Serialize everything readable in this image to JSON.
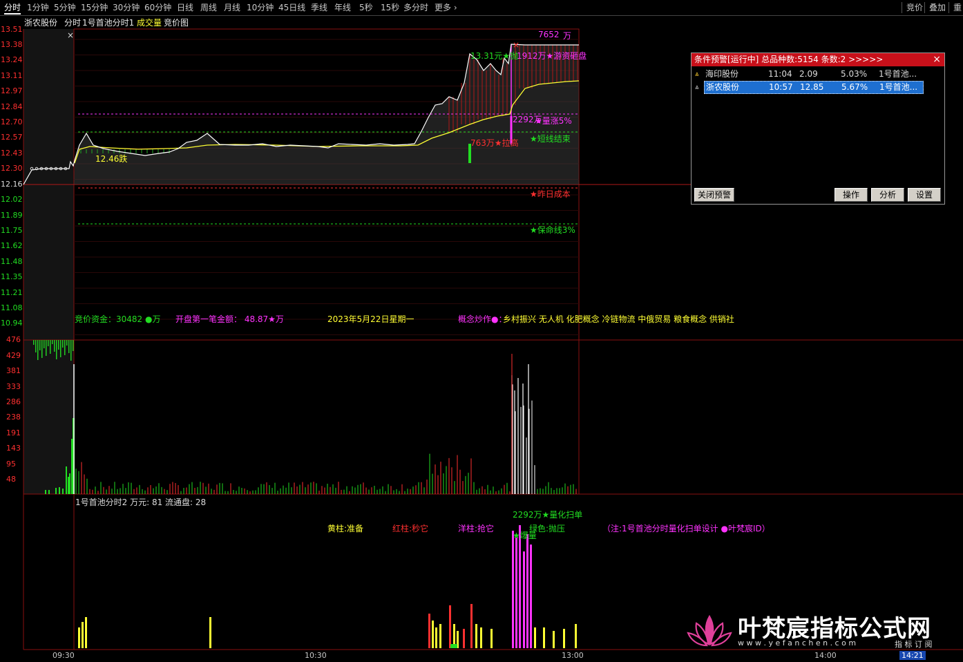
{
  "toolbar": {
    "tabs": [
      "分时",
      "1分钟",
      "5分钟",
      "15分钟",
      "30分钟",
      "60分钟",
      "日线",
      "周线",
      "月线",
      "10分钟",
      "45日线",
      "季线",
      "年线",
      "5秒",
      "15秒",
      "多分时",
      "更多"
    ],
    "right": [
      "竞价",
      "叠加",
      "重"
    ]
  },
  "title": {
    "stock": "浙农股份",
    "sections": [
      "分时",
      "1号首池分时1",
      "成交量",
      "竞价图"
    ]
  },
  "price_axis": [
    "13.51",
    "13.38",
    "13.24",
    "13.11",
    "12.97",
    "12.84",
    "12.70",
    "12.57",
    "12.43",
    "12.30",
    "12.16",
    "12.02",
    "11.89",
    "11.75",
    "11.62",
    "11.48",
    "11.35",
    "11.21",
    "11.08",
    "10.94"
  ],
  "volume_axis": [
    "476",
    "429",
    "381",
    "333",
    "286",
    "238",
    "191",
    "143",
    "95",
    "48"
  ],
  "time_axis": [
    "09:30",
    "10:30",
    "13:00",
    "14:00",
    "14:21"
  ],
  "annotations": {
    "top_value": "7652",
    "top_unit": "万",
    "price_low_label": "12.46跌",
    "high_label": "13.31元★抛",
    "high_amount": "1912万★游资砸盘",
    "mid_amount": "2292万",
    "mid_label": "★量涨5%",
    "low_amount": "763万★拉高",
    "short_end": "★短线结束",
    "yesterday_cost": "★昨日成本",
    "lifeline": "★保命线3%"
  },
  "info_row": {
    "auction_fund": "竞价资金：30482 ●万",
    "first_trade": "开盘第一笔金额：  48.87★万",
    "date": "2023年5月22日星期一",
    "concept_label": "概念炒作●：",
    "concepts": "乡村振兴 无人机 化肥概念 冷链物流 中俄贸易 粮食概念 供销社"
  },
  "indicator": {
    "title": "1号首池分时2 万元: 81 流通盘: 28",
    "amount_label": "2292万★量化扫单",
    "burst_label": "★爆量",
    "legend_yellow": "黄柱:准备",
    "legend_red": "红柱:秒它",
    "legend_magenta": "洋柱:抢它",
    "legend_green": "绿色:抛压",
    "note": "（注:1号首池分时量化扫单设计 ●叶梵宸ID）"
  },
  "alert": {
    "header": "条件预警[运行中] 总品种数:5154 条数:2  >>>>>",
    "rows": [
      {
        "name": "海印股份",
        "time": "11:04",
        "price": "2.09",
        "pct": "5.03%",
        "strategy": "1号首池..."
      },
      {
        "name": "浙农股份",
        "time": "10:57",
        "price": "12.85",
        "pct": "5.67%",
        "strategy": "1号首池..."
      }
    ],
    "close_btn": "关闭预警",
    "op_btn": "操作",
    "analyze_btn": "分析",
    "settings_btn": "设置"
  },
  "watermark": {
    "title": "叶梵宸指标公式网",
    "url": "w w w . y e f a n c h e n . c o m",
    "tag": "指 标 订 阅"
  },
  "colors": {
    "up": "#ff3030",
    "down": "#22dd22",
    "avg": "#ffff33",
    "price_line": "#ffffff",
    "alert_header": "#c8101a",
    "selected": "#1e6fd0",
    "magenta": "#ff33ff"
  }
}
